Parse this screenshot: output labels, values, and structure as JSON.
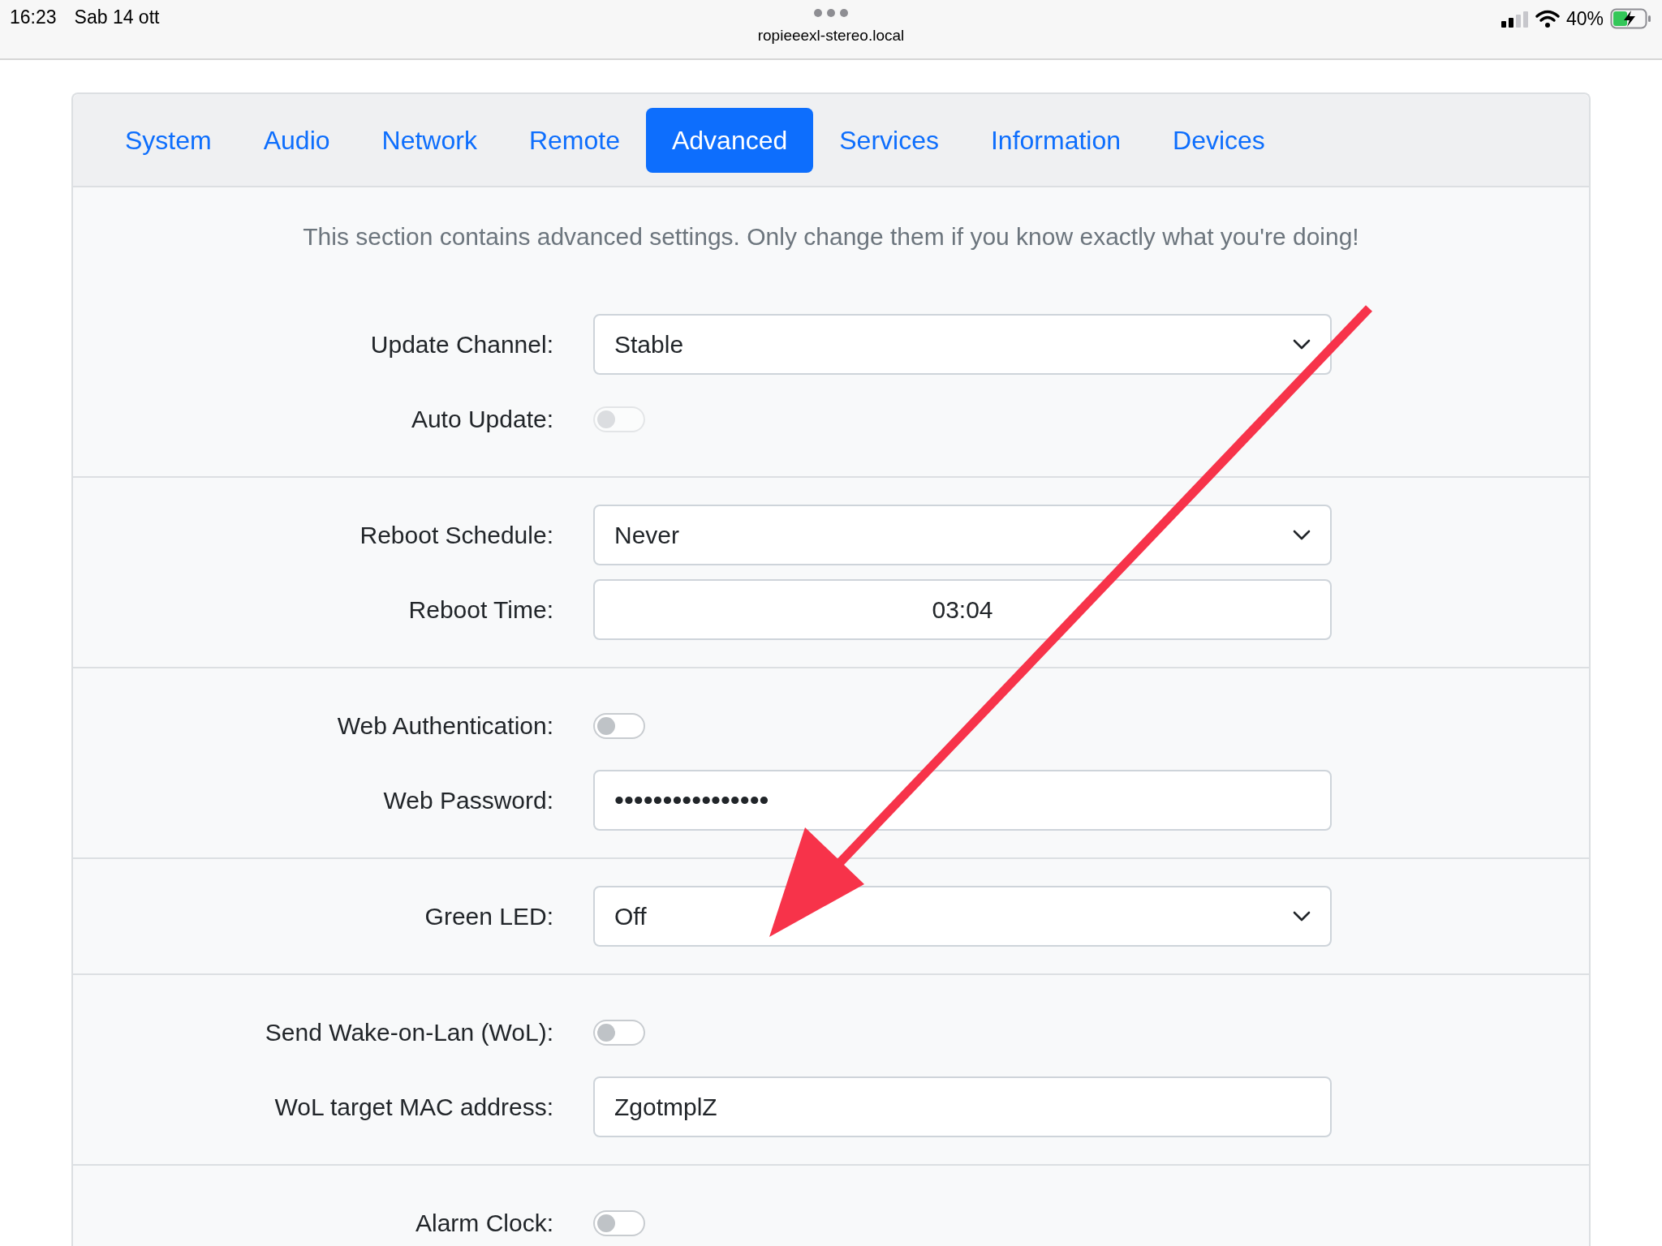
{
  "status_bar": {
    "time": "16:23",
    "date": "Sab 14 ott",
    "url": "ropieeexl-stereo.local",
    "battery": "40%"
  },
  "tabs": [
    {
      "label": "System",
      "selected": false
    },
    {
      "label": "Audio",
      "selected": false
    },
    {
      "label": "Network",
      "selected": false
    },
    {
      "label": "Remote",
      "selected": false
    },
    {
      "label": "Advanced",
      "selected": true
    },
    {
      "label": "Services",
      "selected": false
    },
    {
      "label": "Information",
      "selected": false
    },
    {
      "label": "Devices",
      "selected": false
    }
  ],
  "intro": "This section contains advanced settings. Only change them if you know exactly what you're doing!",
  "sections": [
    {
      "rows": [
        {
          "kind": "select",
          "label": "Update Channel:",
          "value": "Stable"
        },
        {
          "kind": "switch",
          "label": "Auto Update:",
          "on": false,
          "disabled": true
        }
      ]
    },
    {
      "rows": [
        {
          "kind": "select",
          "label": "Reboot Schedule:",
          "value": "Never"
        },
        {
          "kind": "time",
          "label": "Reboot Time:",
          "value": "03:04"
        }
      ]
    },
    {
      "rows": [
        {
          "kind": "switch",
          "label": "Web Authentication:",
          "on": false,
          "disabled": false
        },
        {
          "kind": "password",
          "label": "Web Password:",
          "value": "••••••••••••••••"
        }
      ]
    },
    {
      "rows": [
        {
          "kind": "select",
          "label": "Green LED:",
          "value": "Off"
        }
      ]
    },
    {
      "rows": [
        {
          "kind": "switch",
          "label": "Send Wake-on-Lan (WoL):",
          "on": false,
          "disabled": false
        },
        {
          "kind": "text",
          "label": "WoL target MAC address:",
          "value": "ZgotmplZ"
        }
      ]
    },
    {
      "rows": [
        {
          "kind": "switch",
          "label": "Alarm Clock:",
          "on": false,
          "disabled": false
        }
      ]
    }
  ]
}
